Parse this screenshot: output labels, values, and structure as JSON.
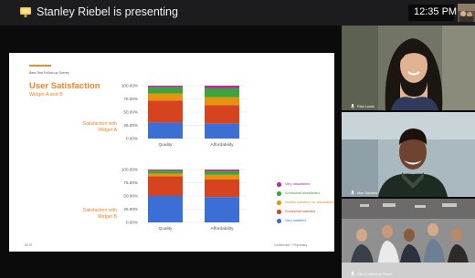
{
  "topbar": {
    "presenter_text": "Stanley Riebel is presenting",
    "time": "12:35 PM"
  },
  "slide": {
    "survey_label": "Beta Test Follow-up Survey",
    "title": "User Satisfaction",
    "subtitle": "Widget A and B",
    "satisfaction_a": [
      "Satisfaction with",
      "Widget A"
    ],
    "satisfaction_b": [
      "Satisfaction with",
      "Widget B"
    ],
    "footer_left": "MLTS",
    "footer_right": "Confidential + Proprietary"
  },
  "legend": [
    {
      "label": "Very dissatisfied",
      "color": "#b52d9a"
    },
    {
      "label": "Somewhat dissatisfied",
      "color": "#3da33d"
    },
    {
      "label": "Neither satisfied nor dissatisfied",
      "color": "#e8930c"
    },
    {
      "label": "Somewhat satisfied",
      "color": "#d6431f"
    },
    {
      "label": "Very satisfied",
      "color": "#3c6fd6"
    }
  ],
  "chart_data": [
    {
      "type": "bar",
      "stacked": true,
      "categories": [
        "Quality",
        "Affordability"
      ],
      "ytick_labels": [
        "0.00%",
        "25.00%",
        "50.00%",
        "75.00%",
        "100.00%"
      ],
      "ylim": [
        0,
        100
      ],
      "series": [
        {
          "name": "Very satisfied",
          "values": [
            30,
            28
          ]
        },
        {
          "name": "Somewhat satisfied",
          "values": [
            42,
            35
          ]
        },
        {
          "name": "Neither satisfied nor dissatisfied",
          "values": [
            13,
            15
          ]
        },
        {
          "name": "Somewhat dissatisfied",
          "values": [
            12,
            17
          ]
        },
        {
          "name": "Very dissatisfied",
          "values": [
            3,
            5
          ]
        }
      ]
    },
    {
      "type": "bar",
      "stacked": true,
      "categories": [
        "Quality",
        "Affordability"
      ],
      "ytick_labels": [
        "0.00%",
        "25.00%",
        "50.00%",
        "75.00%",
        "100.00%"
      ],
      "ylim": [
        0,
        100
      ],
      "series": [
        {
          "name": "Very satisfied",
          "values": [
            50,
            48
          ]
        },
        {
          "name": "Somewhat satisfied",
          "values": [
            37,
            33
          ]
        },
        {
          "name": "Neither satisfied nor dissatisfied",
          "values": [
            5,
            9
          ]
        },
        {
          "name": "Somewhat dissatisfied",
          "values": [
            6,
            7
          ]
        },
        {
          "name": "Very dissatisfied",
          "values": [
            2,
            3
          ]
        }
      ]
    }
  ],
  "participants": [
    {
      "name": "Risa Lumis"
    },
    {
      "name": "Max Sandner"
    },
    {
      "name": "Ritz Conference Room"
    }
  ]
}
